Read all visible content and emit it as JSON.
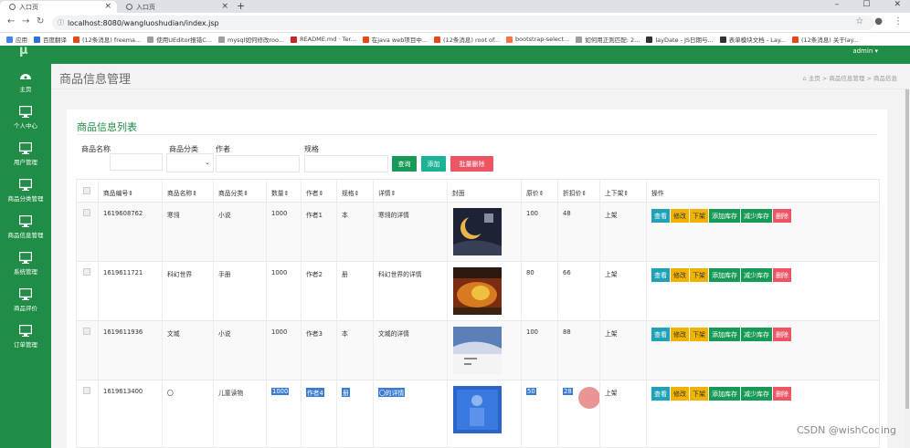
{
  "browser": {
    "tabs": [
      {
        "label": "入口页"
      },
      {
        "label": "入口页"
      }
    ],
    "url": "localhost:8080/wangluoshudian/index.jsp",
    "bookmarks": [
      {
        "label": "应用",
        "color": "#4285f4"
      },
      {
        "label": "百度翻译",
        "color": "#2f6fde"
      },
      {
        "label": "(12条消息) freema...",
        "color": "#e64a19"
      },
      {
        "label": "使用UEditor报错C...",
        "color": "#9e9e9e"
      },
      {
        "label": "mysql如何修改roo...",
        "color": "#9e9e9e"
      },
      {
        "label": "README.md · Ter...",
        "color": "#c62828"
      },
      {
        "label": "在java web项目中...",
        "color": "#e64a19"
      },
      {
        "label": "(12条消息) root of...",
        "color": "#e64a19"
      },
      {
        "label": "bootstrap-select...",
        "color": "#ff7043"
      },
      {
        "label": "如何用正则匹配: 2...",
        "color": "#9e9e9e"
      },
      {
        "label": "layDate - JS日期与...",
        "color": "#333333"
      },
      {
        "label": "表单模块文档 - Lay...",
        "color": "#333333"
      },
      {
        "label": "(12条消息) 关于lay...",
        "color": "#e64a19"
      }
    ]
  },
  "sidebar": {
    "logo": "μ",
    "items": [
      {
        "label": "主页",
        "icon": "dashboard-icon"
      },
      {
        "label": "个人中心",
        "icon": "monitor-icon"
      },
      {
        "label": "用户管理",
        "icon": "monitor-icon"
      },
      {
        "label": "商品分类管理",
        "icon": "monitor-icon"
      },
      {
        "label": "商品信息管理",
        "icon": "monitor-icon"
      },
      {
        "label": "系统管理",
        "icon": "monitor-icon"
      },
      {
        "label": "商品评价",
        "icon": "monitor-icon"
      },
      {
        "label": "订单管理",
        "icon": "monitor-icon"
      }
    ]
  },
  "header": {
    "admin": "admin ▾",
    "title": "商品信息管理",
    "breadcrumb": "⌂ 主页 > 商品信息管理 > 商品信息"
  },
  "panel": {
    "title": "商品信息列表",
    "filters": {
      "name_label": "商品名称",
      "category_label": "商品分类",
      "author_label": "作者",
      "spec_label": "规格"
    },
    "buttons": {
      "query": "查询",
      "add": "添加",
      "batch_delete": "批量删除"
    }
  },
  "table": {
    "headers": [
      "商品编号⇕",
      "商品名称⇕",
      "商品分类⇕",
      "数量⇕",
      "作者⇕",
      "规格⇕",
      "详情⇕",
      "封面",
      "原价⇕",
      "折扣价⇕",
      "上下架⇕",
      "操作"
    ],
    "ops": [
      "查看",
      "修改",
      "下架",
      "添加库存",
      "减少库存",
      "删除"
    ],
    "rows": [
      {
        "id": "1619608762",
        "name": "寒翎",
        "category": "小说",
        "qty": "1000",
        "author": "作者1",
        "spec": "本",
        "detail": "寒翎的详情",
        "price": "100",
        "discount": "48",
        "status": "上架"
      },
      {
        "id": "1619611721",
        "name": "科幻世界",
        "category": "手册",
        "qty": "1000",
        "author": "作者2",
        "spec": "册",
        "detail": "科幻世界的详情",
        "price": "80",
        "discount": "66",
        "status": "上架"
      },
      {
        "id": "1619611936",
        "name": "文城",
        "category": "小说",
        "qty": "1000",
        "author": "作者3",
        "spec": "本",
        "detail": "文城的详情",
        "price": "100",
        "discount": "88",
        "status": "上架"
      },
      {
        "id": "1619613400",
        "name": "〇",
        "category": "儿童读物",
        "qty": "1000",
        "author": "作者4",
        "spec": "册",
        "detail": "〇的详情",
        "price": "50",
        "discount": "28",
        "status": "上架"
      }
    ]
  },
  "colors": {
    "sidebar": "#1f8d45",
    "query": "#169a55",
    "add": "#1ab394",
    "delete": "#ed5565",
    "view": "#1fa2b8",
    "edit": "#f0b400",
    "selection": "#3a7bd5"
  },
  "watermark": "CSDN @wishCoding"
}
